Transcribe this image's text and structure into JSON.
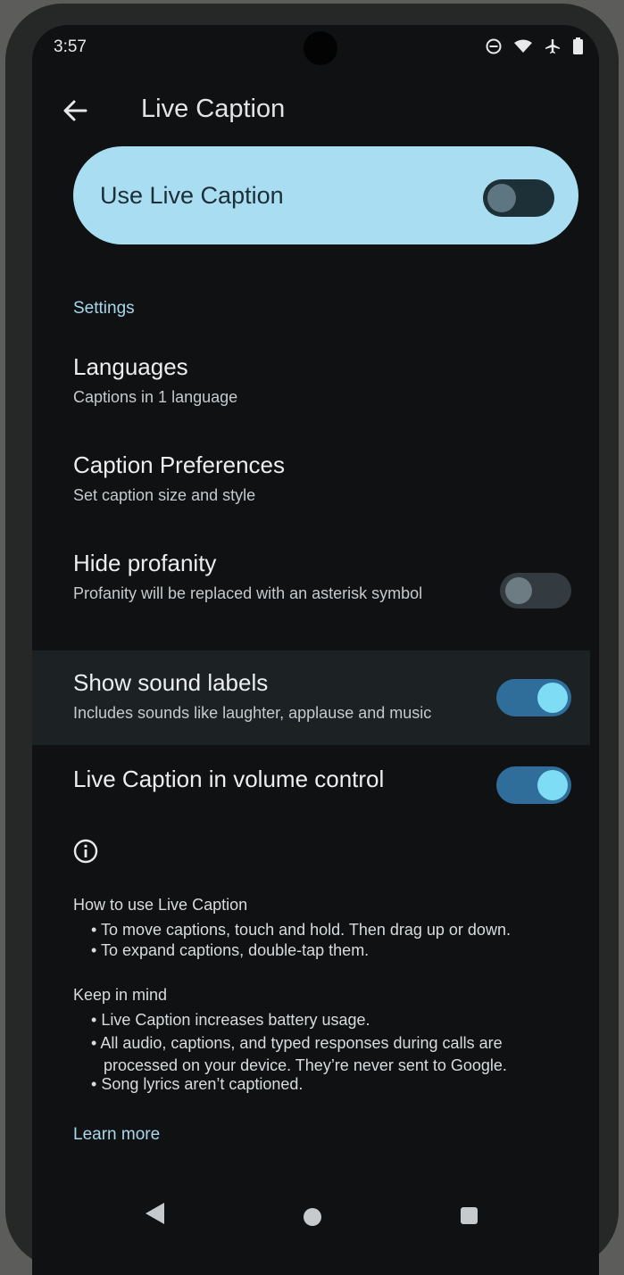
{
  "status_bar": {
    "time": "3:57",
    "icons": [
      "do-not-disturb-icon",
      "wifi-icon",
      "airplane-icon",
      "battery-icon"
    ]
  },
  "header": {
    "title": "Live Caption"
  },
  "main_toggle": {
    "label": "Use Live Caption",
    "on": false
  },
  "settings": {
    "heading": "Settings",
    "languages": {
      "title": "Languages",
      "subtitle": "Captions in 1 language"
    },
    "caption_preferences": {
      "title": "Caption Preferences",
      "subtitle": "Set caption size and style"
    },
    "hide_profanity": {
      "title": "Hide profanity",
      "subtitle": "Profanity will be replaced with an asterisk symbol",
      "on": false
    },
    "sound_labels": {
      "title": "Show sound labels",
      "subtitle": "Includes sounds like laughter, applause and music",
      "on": true
    },
    "volume_control": {
      "title": "Live Caption in volume control",
      "on": true
    }
  },
  "info": {
    "how_to_title": "How to use Live Caption",
    "how_to": [
      "To move captions, touch and hold. Then drag up or down.",
      "To expand captions, double-tap them."
    ],
    "keep_in_mind_title": "Keep in mind",
    "keep_in_mind": [
      "Live Caption increases battery usage.",
      "All audio, captions, and typed responses during calls are",
      "processed on your device. They’re never sent to Google.",
      "Song lyrics aren’t captioned."
    ],
    "learn_more": "Learn more"
  },
  "colors": {
    "accent": "#a8d7ec",
    "card": "#a9def2",
    "toggle_on": "#2f6e9a",
    "knob_on": "#7fdcf5"
  }
}
